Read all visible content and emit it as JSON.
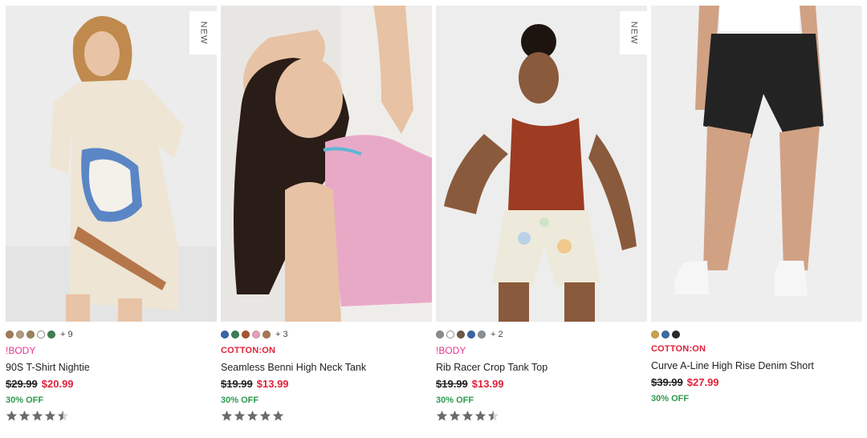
{
  "products": [
    {
      "badge": "NEW",
      "swatch_colors": [
        "#a47b52",
        "#b29a7e",
        "#9c8258",
        "#ffffff",
        "#3f7f4f"
      ],
      "more_colors": "+ 9",
      "brand": "!BODY",
      "name": "90S T-Shirt Nightie",
      "was_price": "$29.99",
      "now_price": "$20.99",
      "discount": "30% OFF",
      "rating": 4.5
    },
    {
      "badge": "",
      "swatch_colors": [
        "#3a65a8",
        "#3e7d57",
        "#a8542e",
        "#e2a1b9",
        "#a67955"
      ],
      "more_colors": "+ 3",
      "brand": "COTTON:ON",
      "name": "Seamless Benni High Neck Tank",
      "was_price": "$19.99",
      "now_price": "$13.99",
      "discount": "30% OFF",
      "rating": 5
    },
    {
      "badge": "NEW",
      "swatch_colors": [
        "#8c8c8c",
        "#ffffff",
        "#6e5a44",
        "#3a64a5",
        "#8a9098"
      ],
      "more_colors": "+ 2",
      "brand": "!BODY",
      "name": "Rib Racer Crop Tank Top",
      "was_price": "$19.99",
      "now_price": "$13.99",
      "discount": "30% OFF",
      "rating": 4.5
    },
    {
      "badge": "",
      "swatch_colors": [
        "#c9a34a",
        "#3b6ca3",
        "#2a2a2a"
      ],
      "more_colors": "",
      "brand": "COTTON:ON",
      "name": "Curve A-Line High Rise Denim Short",
      "was_price": "$39.99",
      "now_price": "$27.99",
      "discount": "30% OFF",
      "rating": null
    }
  ],
  "colors": {
    "body_brand": "#e8368f",
    "cotton_brand": "#e0223a",
    "sale_price": "#e0223a",
    "discount": "#2e9a4e",
    "star": "#6b6b6b"
  }
}
